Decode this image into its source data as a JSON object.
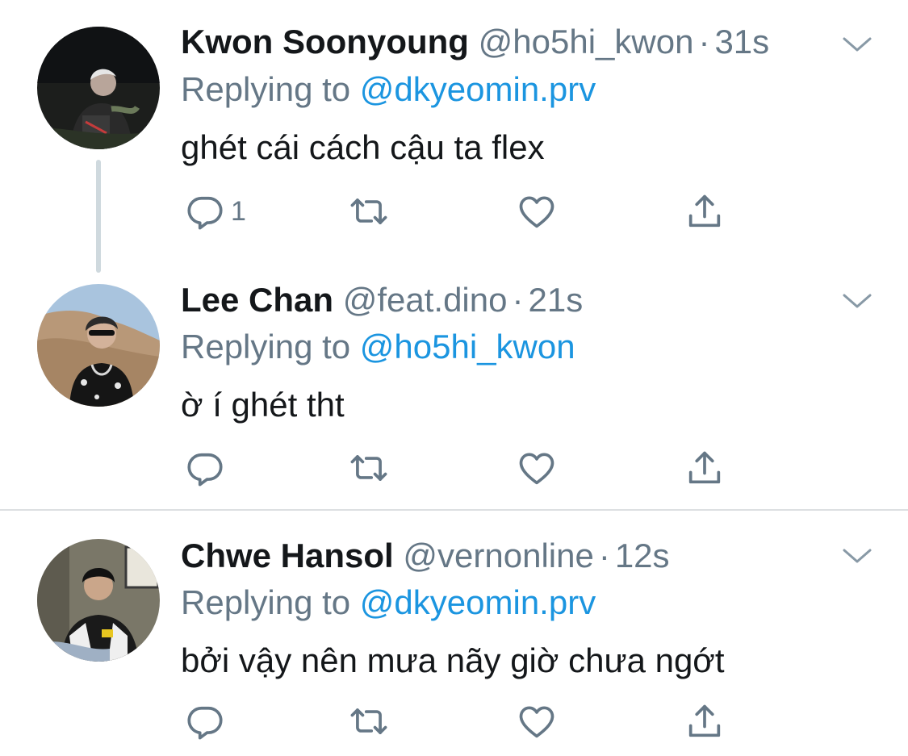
{
  "colors": {
    "name": "#14171a",
    "secondary": "#657786",
    "link": "#1b95e0",
    "thread_line": "#cfd9de",
    "divider": "#dcdfe2"
  },
  "tweets": [
    {
      "display_name": "Kwon Soonyoung",
      "handle": "@ho5hi_kwon",
      "separator": "·",
      "time": "31s",
      "reply_prefix": "Replying to",
      "reply_to": "@dkyeomin.prv",
      "text": "ghét cái cách cậu ta flex",
      "reply_count": "1",
      "icons": [
        "reply-icon",
        "retweet-icon",
        "like-icon",
        "share-icon",
        "chevron-down-icon"
      ]
    },
    {
      "display_name": "Lee Chan",
      "handle": "@feat.dino",
      "separator": "·",
      "time": "21s",
      "reply_prefix": "Replying to",
      "reply_to": "@ho5hi_kwon",
      "text": "ờ í ghét tht",
      "reply_count": "",
      "icons": [
        "reply-icon",
        "retweet-icon",
        "like-icon",
        "share-icon",
        "chevron-down-icon"
      ]
    },
    {
      "display_name": "Chwe Hansol",
      "handle": "@vernonline",
      "separator": "·",
      "time": "12s",
      "reply_prefix": "Replying to",
      "reply_to": "@dkyeomin.prv",
      "text": "bởi vậy nên mưa nãy giờ chưa ngớt",
      "reply_count": "",
      "icons": [
        "reply-icon",
        "retweet-icon",
        "like-icon",
        "share-icon",
        "chevron-down-icon"
      ]
    }
  ]
}
